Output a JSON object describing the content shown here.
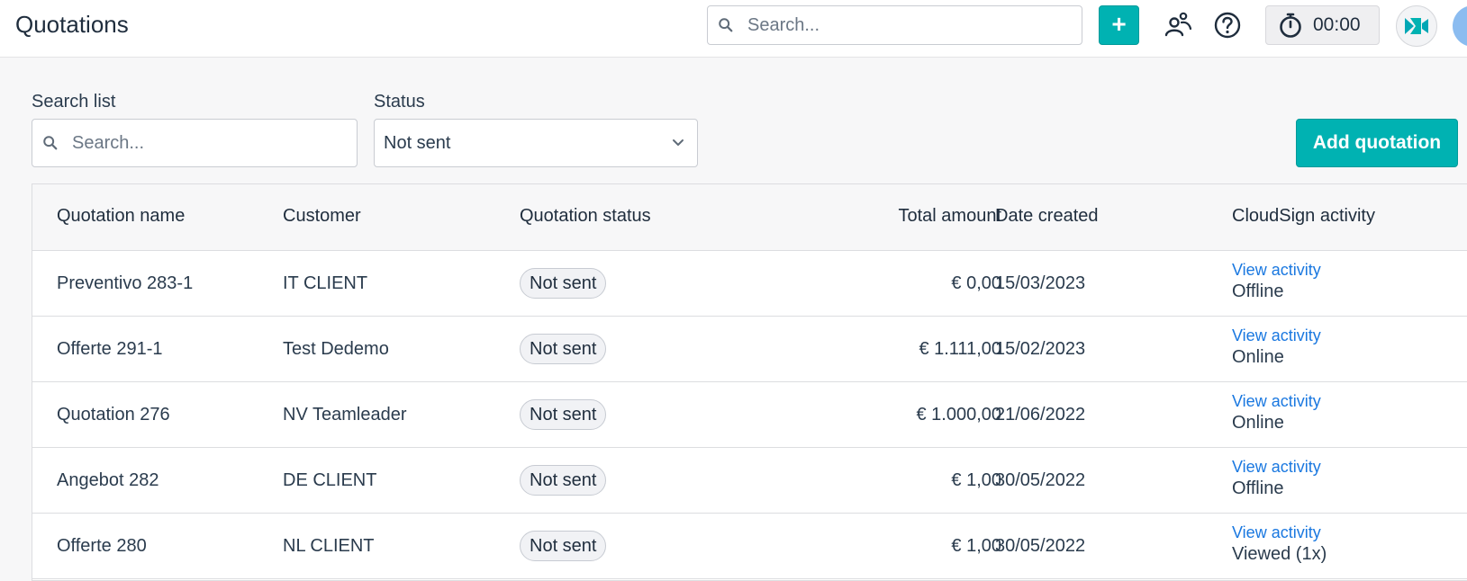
{
  "header": {
    "title": "Quotations",
    "search_placeholder": "Search...",
    "add_label": "+",
    "timer": "00:00"
  },
  "filters": {
    "search_label": "Search list",
    "search_placeholder": "Search...",
    "status_label": "Status",
    "status_value": "Not sent",
    "add_button": "Add quotation"
  },
  "table": {
    "columns": [
      "Quotation name",
      "Customer",
      "Quotation status",
      "Total amount",
      "Date created",
      "CloudSign activity"
    ],
    "rows": [
      {
        "name": "Preventivo 283-1",
        "customer": "IT CLIENT",
        "status": "Not sent",
        "amount": "€ 0,00",
        "date": "15/03/2023",
        "link": "View activity",
        "activity": "Offline"
      },
      {
        "name": "Offerte 291-1",
        "customer": "Test Dedemo",
        "status": "Not sent",
        "amount": "€ 1.111,00",
        "date": "15/02/2023",
        "link": "View activity",
        "activity": "Online"
      },
      {
        "name": "Quotation 276",
        "customer": "NV Teamleader",
        "status": "Not sent",
        "amount": "€ 1.000,00",
        "date": "21/06/2022",
        "link": "View activity",
        "activity": "Online"
      },
      {
        "name": "Angebot 282",
        "customer": "DE CLIENT",
        "status": "Not sent",
        "amount": "€ 1,00",
        "date": "30/05/2022",
        "link": "View activity",
        "activity": "Offline"
      },
      {
        "name": "Offerte 280",
        "customer": "NL CLIENT",
        "status": "Not sent",
        "amount": "€ 1,00",
        "date": "30/05/2022",
        "link": "View activity",
        "activity": "Viewed (1x)"
      }
    ]
  },
  "colors": {
    "accent": "#00b2b2",
    "link": "#1a78e0"
  }
}
